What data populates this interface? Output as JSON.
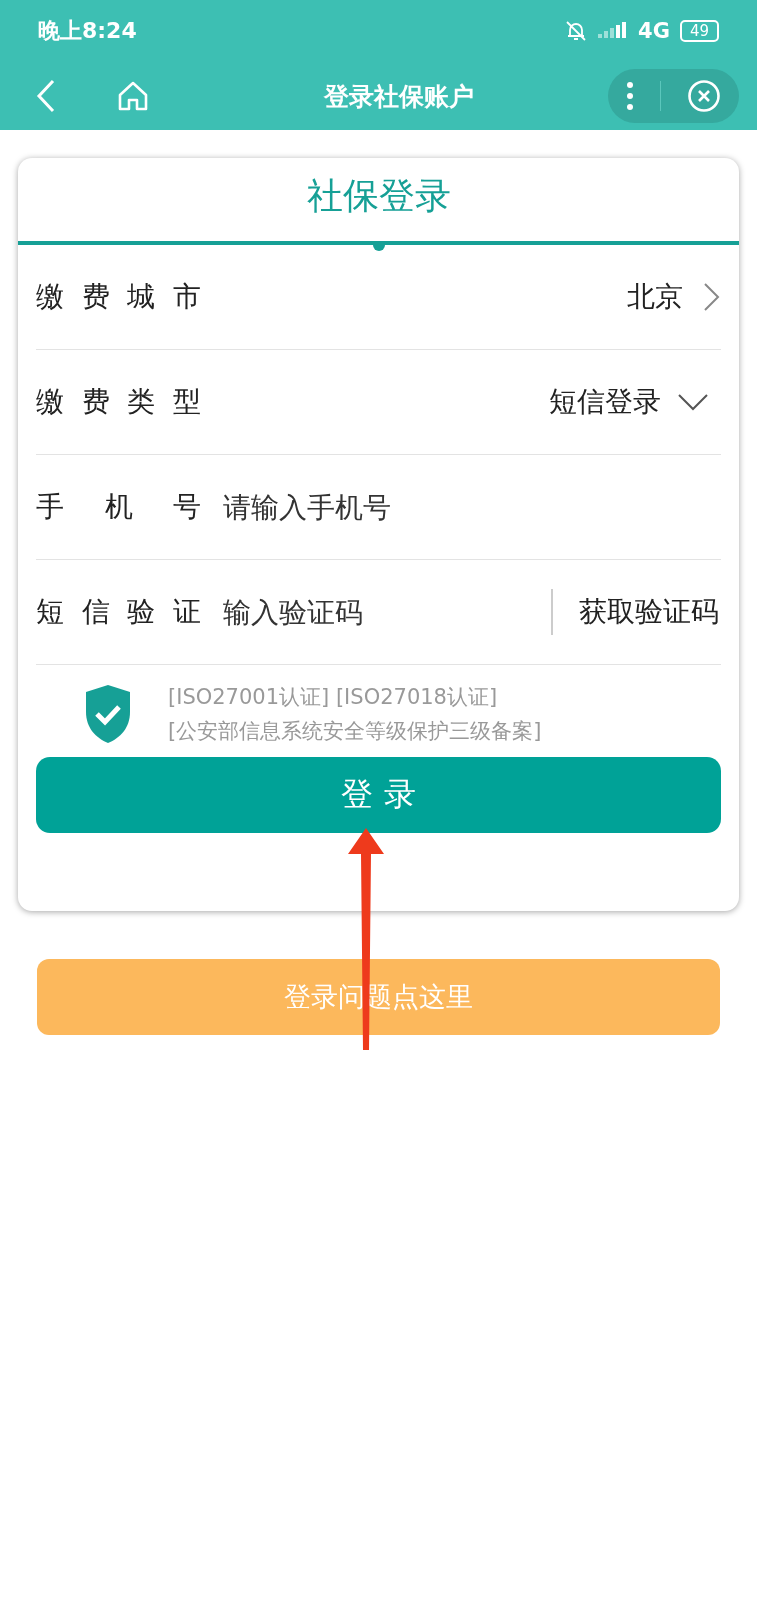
{
  "status_bar": {
    "time": "晚上8:24",
    "network": "4G",
    "battery": "49"
  },
  "nav_bar": {
    "title": "登录社保账户"
  },
  "card": {
    "tabs": [
      {
        "label": "社保登录",
        "selected": true
      }
    ],
    "rows": [
      {
        "kind": "link",
        "label": "缴费城市",
        "value": "北京"
      },
      {
        "kind": "dropdown",
        "label": "缴费类型",
        "value": "短信登录"
      },
      {
        "kind": "input",
        "label": "手机号",
        "placeholder": "请输入手机号"
      },
      {
        "kind": "code",
        "label": "短信验证",
        "placeholder": "输入验证码",
        "action": "获取验证码"
      }
    ],
    "certificates": [
      "[ISO27001认证] [ISO27018认证]",
      "[公安部信息系统安全等级保护三级备案]"
    ],
    "login_button": "登 录"
  },
  "help_button": "登录问题点这里"
}
